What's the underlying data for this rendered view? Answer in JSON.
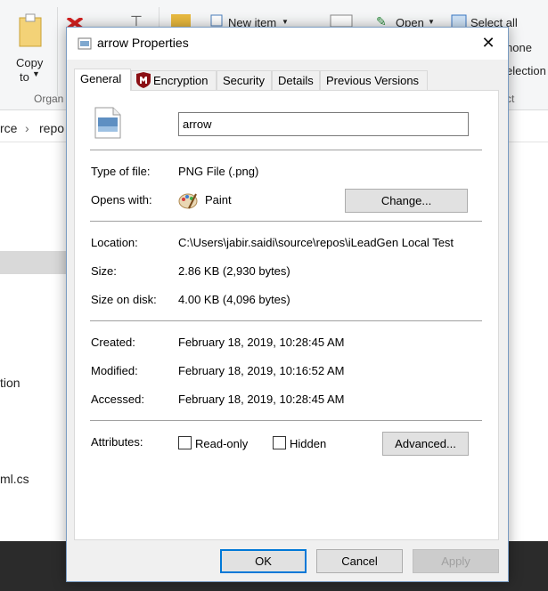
{
  "background": {
    "ribbon": {
      "copy_label": "Copy",
      "copy_to_label": "to",
      "new_item_label": "New item",
      "open_label": "Open",
      "select_all_label": "Select all",
      "select_none_label": "none",
      "invert_selection_label": "election",
      "organize_group": "Organ",
      "select_group": "ct"
    },
    "address": {
      "crumb_1": "rce",
      "crumb_2": "repo"
    },
    "rows": {
      "item_tion": "tion",
      "item_mlcs": "ml.cs"
    }
  },
  "dialog": {
    "title": "arrow Properties",
    "close_glyph": "✕",
    "tabs": [
      "General",
      "Encryption",
      "Security",
      "Details",
      "Previous Versions"
    ],
    "file_name": "arrow",
    "type_label": "Type of file:",
    "type_value": "PNG File (.png)",
    "opens_label": "Opens with:",
    "opens_value": "Paint",
    "change_button": "Change...",
    "location_label": "Location:",
    "location_value": "C:\\Users\\jabir.saidi\\source\\repos\\iLeadGen Local Test",
    "size_label": "Size:",
    "size_value": "2.86 KB (2,930 bytes)",
    "size_disk_label": "Size on disk:",
    "size_disk_value": "4.00 KB (4,096 bytes)",
    "created_label": "Created:",
    "created_value": "February 18, 2019, 10:28:45 AM",
    "modified_label": "Modified:",
    "modified_value": "February 18, 2019, 10:16:52 AM",
    "accessed_label": "Accessed:",
    "accessed_value": "February 18, 2019, 10:28:45 AM",
    "attributes_label": "Attributes:",
    "readonly_label": "Read-only",
    "hidden_label": "Hidden",
    "advanced_button": "Advanced...",
    "ok_button": "OK",
    "cancel_button": "Cancel",
    "apply_button": "Apply"
  },
  "colors": {
    "accent": "#0078d7",
    "encryption_icon": "#8b0f14"
  }
}
